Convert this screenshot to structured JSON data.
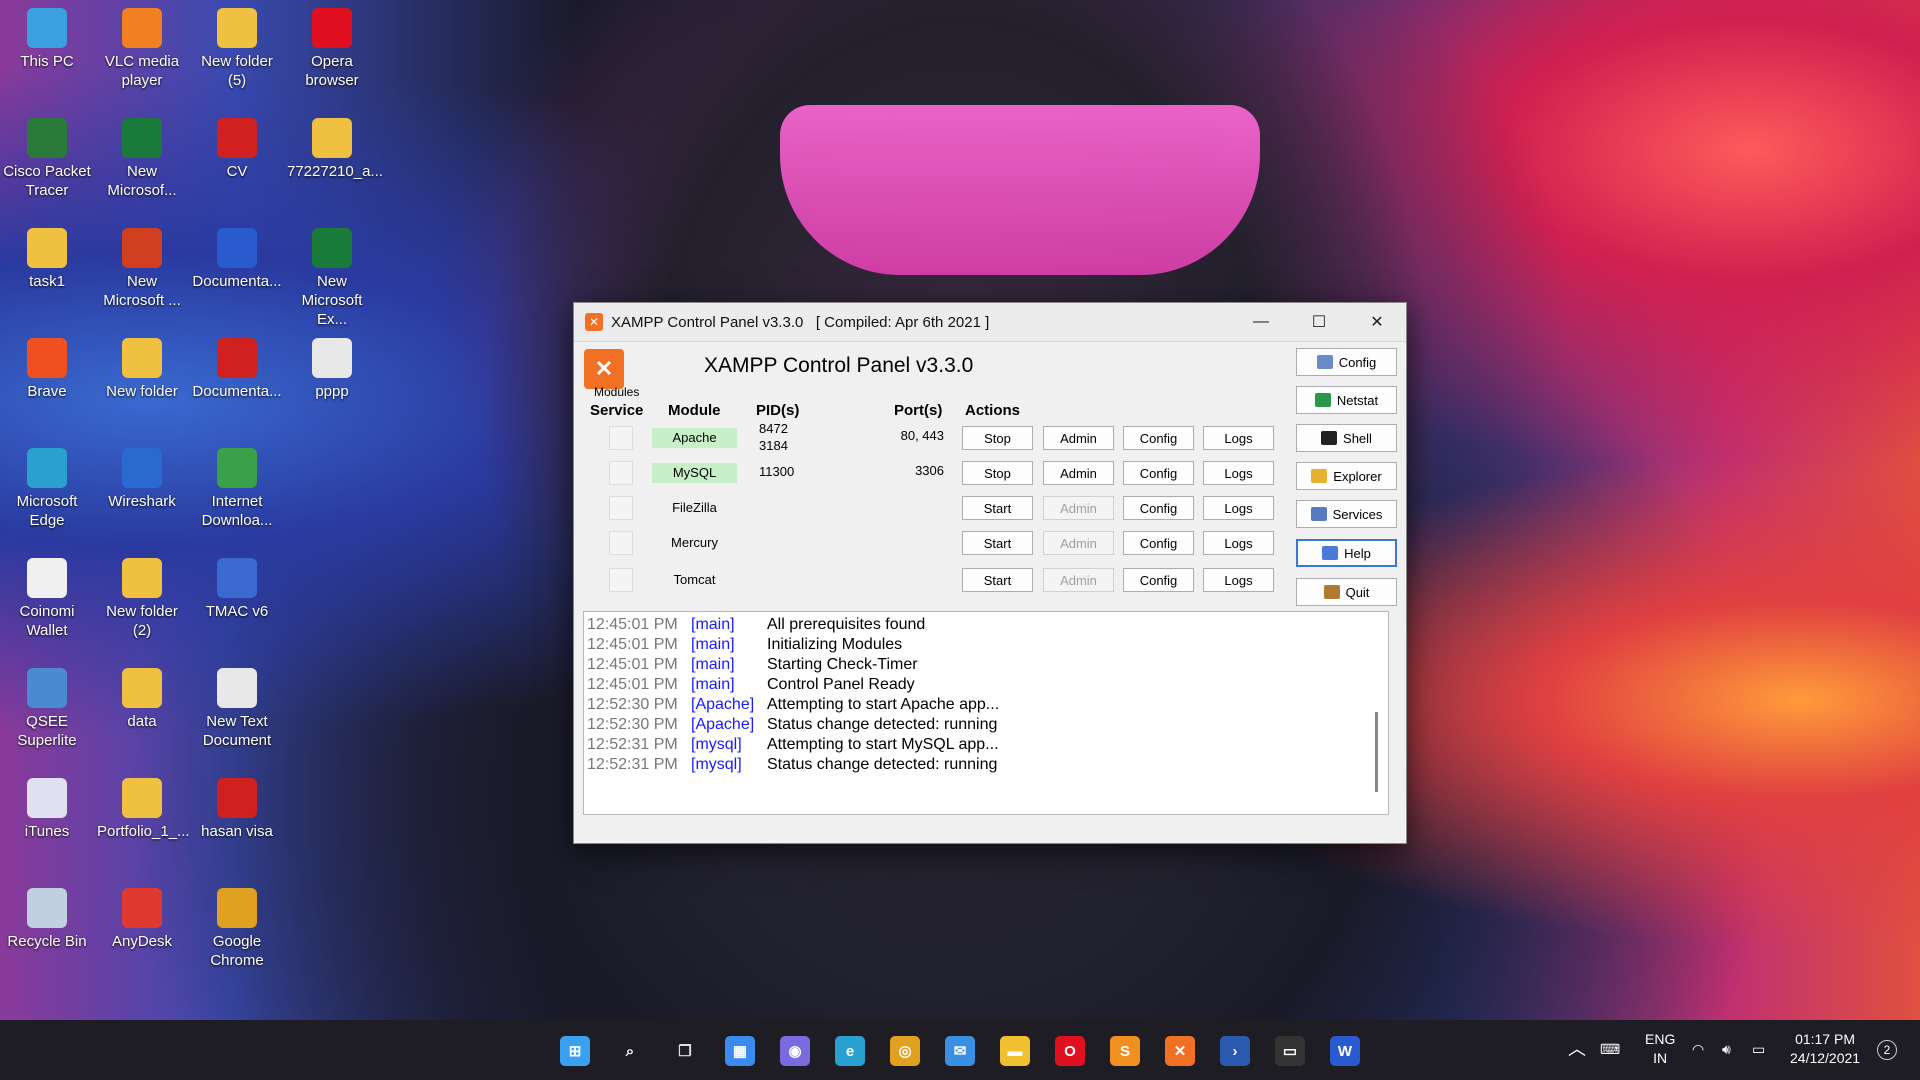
{
  "desktop": {
    "icons": [
      {
        "label": "This PC",
        "icon": "computer-icon"
      },
      {
        "label": "VLC media player",
        "icon": "vlc-icon"
      },
      {
        "label": "New folder (5)",
        "icon": "folder-icon"
      },
      {
        "label": "Opera browser",
        "icon": "opera-icon"
      },
      {
        "label": "Cisco Packet Tracer",
        "icon": "cisco-icon"
      },
      {
        "label": "New Microsof...",
        "icon": "excel-icon"
      },
      {
        "label": "CV",
        "icon": "pdf-icon"
      },
      {
        "label": "77227210_a...",
        "icon": "folder-icon"
      },
      {
        "label": "task1",
        "icon": "folder-icon"
      },
      {
        "label": "New Microsoft ...",
        "icon": "powerpoint-icon"
      },
      {
        "label": "Documenta...",
        "icon": "word-icon"
      },
      {
        "label": "New Microsoft Ex...",
        "icon": "excel-icon"
      },
      {
        "label": "Brave",
        "icon": "brave-icon"
      },
      {
        "label": "New folder",
        "icon": "folder-icon"
      },
      {
        "label": "Documenta...",
        "icon": "pdf-icon"
      },
      {
        "label": "pppp",
        "icon": "text-file-icon"
      },
      {
        "label": "Microsoft Edge",
        "icon": "edge-icon"
      },
      {
        "label": "Wireshark",
        "icon": "wireshark-icon"
      },
      {
        "label": "Internet Downloa...",
        "icon": "idm-icon"
      },
      {
        "label": "Coinomi Wallet",
        "icon": "coinomi-icon"
      },
      {
        "label": "New folder (2)",
        "icon": "folder-icon"
      },
      {
        "label": "TMAC v6",
        "icon": "tmac-icon"
      },
      {
        "label": "QSEE Superlite",
        "icon": "qsee-icon"
      },
      {
        "label": "data",
        "icon": "folder-icon"
      },
      {
        "label": "New Text Document",
        "icon": "text-file-icon"
      },
      {
        "label": "iTunes",
        "icon": "itunes-icon"
      },
      {
        "label": "Portfolio_1_...",
        "icon": "folder-icon"
      },
      {
        "label": "hasan visa",
        "icon": "pdf-icon"
      },
      {
        "label": "Recycle Bin",
        "icon": "recycle-bin-icon"
      },
      {
        "label": "AnyDesk",
        "icon": "anydesk-icon"
      },
      {
        "label": "Google Chrome",
        "icon": "chrome-icon"
      }
    ]
  },
  "window": {
    "title": "XAMPP Control Panel v3.3.0   [ Compiled: Apr 6th 2021 ]",
    "app_title": "XAMPP Control Panel v3.3.0",
    "modules_label": "Modules",
    "headers": {
      "service": "Service",
      "module": "Module",
      "pids": "PID(s)",
      "ports": "Port(s)",
      "actions": "Actions"
    },
    "modules": [
      {
        "name": "Apache",
        "pids": "8472\n3184",
        "ports": "80, 443",
        "start_label": "Stop",
        "admin": "Admin",
        "config": "Config",
        "logs": "Logs",
        "running": true
      },
      {
        "name": "MySQL",
        "pids": "11300",
        "ports": "3306",
        "start_label": "Stop",
        "admin": "Admin",
        "config": "Config",
        "logs": "Logs",
        "running": true
      },
      {
        "name": "FileZilla",
        "pids": "",
        "ports": "",
        "start_label": "Start",
        "admin": "Admin",
        "config": "Config",
        "logs": "Logs",
        "running": false
      },
      {
        "name": "Mercury",
        "pids": "",
        "ports": "",
        "start_label": "Start",
        "admin": "Admin",
        "config": "Config",
        "logs": "Logs",
        "running": false
      },
      {
        "name": "Tomcat",
        "pids": "",
        "ports": "",
        "start_label": "Start",
        "admin": "Admin",
        "config": "Config",
        "logs": "Logs",
        "running": false
      }
    ],
    "side_buttons": [
      {
        "label": "Config",
        "icon": "wrench-icon",
        "color": "#6a8ac8"
      },
      {
        "label": "Netstat",
        "icon": "globe-icon",
        "color": "#2a9a4a"
      },
      {
        "label": "Shell",
        "icon": "terminal-icon",
        "color": "#222222"
      },
      {
        "label": "Explorer",
        "icon": "folder-icon",
        "color": "#e8b030"
      },
      {
        "label": "Services",
        "icon": "services-icon",
        "color": "#5a7ac0"
      },
      {
        "label": "Help",
        "icon": "help-icon",
        "color": "#4a7ad8"
      },
      {
        "label": "Quit",
        "icon": "door-icon",
        "color": "#b07a30"
      }
    ],
    "log": [
      {
        "time": "12:45:01 PM",
        "source": "[main]",
        "message": "All prerequisites found"
      },
      {
        "time": "12:45:01 PM",
        "source": "[main]",
        "message": "Initializing Modules"
      },
      {
        "time": "12:45:01 PM",
        "source": "[main]",
        "message": "Starting Check-Timer"
      },
      {
        "time": "12:45:01 PM",
        "source": "[main]",
        "message": "Control Panel Ready"
      },
      {
        "time": "12:52:30 PM",
        "source": "[Apache]",
        "message": "Attempting to start Apache app..."
      },
      {
        "time": "12:52:30 PM",
        "source": "[Apache]",
        "message": "Status change detected: running"
      },
      {
        "time": "12:52:31 PM",
        "source": "[mysql]",
        "message": "Attempting to start MySQL app..."
      },
      {
        "time": "12:52:31 PM",
        "source": "[mysql]",
        "message": "Status change detected: running"
      }
    ]
  },
  "taskbar": {
    "apps": [
      {
        "name": "start-icon",
        "color": "#3aa0f0"
      },
      {
        "name": "search-icon",
        "color": "#ffffff"
      },
      {
        "name": "task-view-icon",
        "color": "#dddddd"
      },
      {
        "name": "widgets-icon",
        "color": "#3a8af0"
      },
      {
        "name": "teams-chat-icon",
        "color": "#7a6ae0"
      },
      {
        "name": "edge-icon",
        "color": "#2aa0d0"
      },
      {
        "name": "chrome-icon",
        "color": "#e0a020"
      },
      {
        "name": "mail-icon",
        "color": "#3a90e0"
      },
      {
        "name": "file-explorer-icon",
        "color": "#f0c030"
      },
      {
        "name": "opera-icon",
        "color": "#e01020"
      },
      {
        "name": "sublime-icon",
        "color": "#f09020"
      },
      {
        "name": "xampp-icon",
        "color": "#f27023"
      },
      {
        "name": "powershell-icon",
        "color": "#2a5ab0"
      },
      {
        "name": "terminal-icon",
        "color": "#333333"
      },
      {
        "name": "word-icon",
        "color": "#2a5ad0"
      }
    ],
    "lang": "ENG",
    "region": "IN",
    "time": "01:17 PM",
    "date": "24/12/2021",
    "notification_count": "2"
  }
}
